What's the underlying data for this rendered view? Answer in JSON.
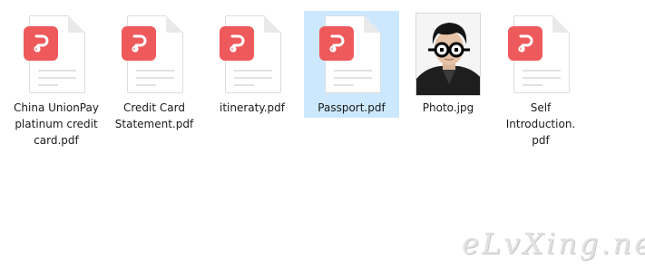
{
  "files": [
    {
      "name": "China UnionPay platinum credit card.pdf",
      "type": "pdf",
      "icon": "pdf-file-icon",
      "selected": false
    },
    {
      "name": "Credit Card Statement.pdf",
      "type": "pdf",
      "icon": "pdf-file-icon",
      "selected": false
    },
    {
      "name": "itineraty.pdf",
      "type": "pdf",
      "icon": "pdf-file-icon",
      "selected": false
    },
    {
      "name": "Passport.pdf",
      "type": "pdf",
      "icon": "pdf-file-icon",
      "selected": true
    },
    {
      "name": "Photo.jpg",
      "type": "jpg",
      "icon": "photo-thumbnail",
      "selected": false
    },
    {
      "name": "Self Introduction.pdf",
      "type": "pdf",
      "icon": "pdf-file-icon",
      "selected": false
    }
  ],
  "colors": {
    "pdf_badge": "#ee5a5c",
    "selection": "#cce8ff",
    "label_text": "#1a1a1a"
  },
  "watermark": "eLvXing.net"
}
